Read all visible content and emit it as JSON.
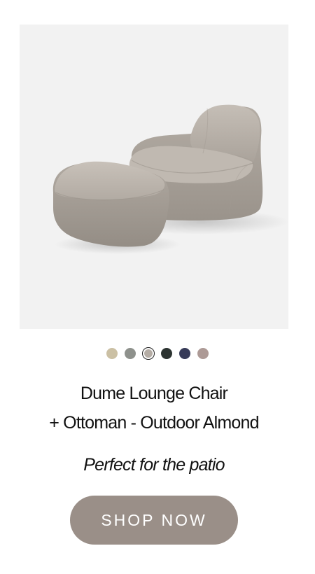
{
  "product": {
    "title_line1": "Dume Lounge Chair",
    "title_line2": "+ Ottoman - Outdoor Almond",
    "tagline": "Perfect for the patio",
    "image_label": "lounge-chair-and-ottoman-photo"
  },
  "swatches": [
    {
      "color": "#cbc0a4",
      "selected": false
    },
    {
      "color": "#8e918c",
      "selected": false
    },
    {
      "color": "#b4aca4",
      "selected": true
    },
    {
      "color": "#2c3331",
      "selected": false
    },
    {
      "color": "#373b58",
      "selected": false
    },
    {
      "color": "#ad9a96",
      "selected": false
    }
  ],
  "cta": {
    "label": "SHOP NOW",
    "background": "#9a8f88"
  },
  "colors": {
    "image_background": "#f2f2f2",
    "fabric": "#b7b0a8"
  }
}
